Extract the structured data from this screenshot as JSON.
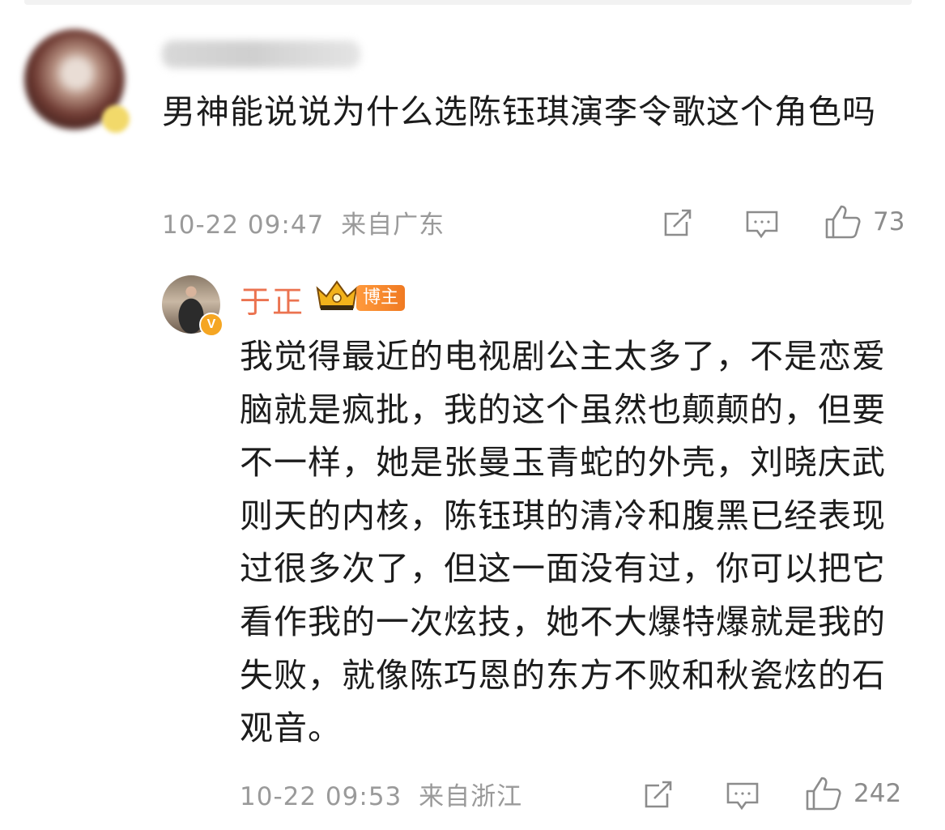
{
  "comment": {
    "username": "",
    "text": "男神能说说为什么选陈钰琪演李令歌这个角色吗",
    "time": "10-22 09:47",
    "location": "来自广东",
    "likes": "73"
  },
  "reply": {
    "username": "于正",
    "tag": "博主",
    "text": "我觉得最近的电视剧公主太多了，不是恋爱脑就是疯批，我的这个虽然也颠颠的，但要不一样，她是张曼玉青蛇的外壳，刘晓庆武则天的内核，陈钰琪的清冷和腹黑已经表现过很多次了，但这一面没有过，你可以把它看作我的一次炫技，她不大爆特爆就是我的失败，就像陈巧恩的东方不败和秋瓷炫的石观音。",
    "time": "10-22 09:53",
    "location": "来自浙江",
    "likes": "242"
  },
  "icons": [
    "share-icon",
    "comment-icon",
    "like-icon",
    "crown-icon",
    "verified-v-icon"
  ],
  "colors": {
    "username_orange": "#eb7350",
    "meta_gray": "#9a9a9a",
    "tag_orange": "#f07a22",
    "verified_gold": "#f5a623"
  }
}
